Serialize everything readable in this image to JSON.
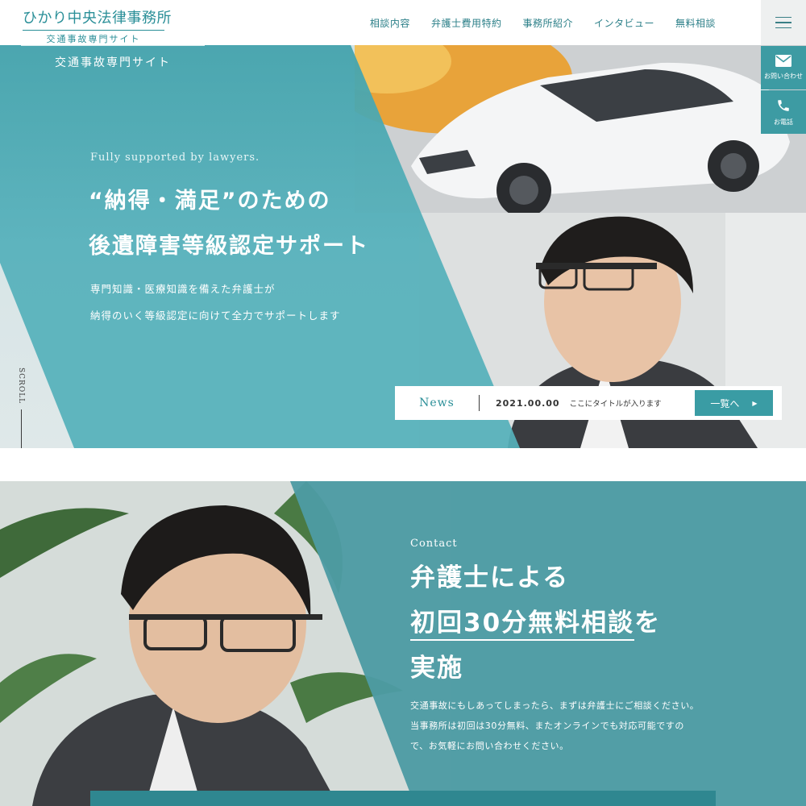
{
  "header": {
    "logo_main": "ひかり中央法律事務所",
    "logo_sub": "交通事故専門サイト",
    "nav": [
      "相談内容",
      "弁護士費用特約",
      "事務所紹介",
      "インタビュー",
      "無料相談"
    ]
  },
  "side": {
    "mail_label": "お問い合わせ",
    "tel_label": "お電話"
  },
  "hero": {
    "site_name": "交通事故専門サイト",
    "en": "Fully supported by lawyers.",
    "title_line1": "“納得・満足”のための",
    "title_line2": "後遺障害等級認定サポート",
    "desc_line1": "専門知識・医療知識を備えた弁護士が",
    "desc_line2": "納得のいく等級認定に向けて全力でサポートします",
    "scroll": "SCROLL"
  },
  "news": {
    "title": "News",
    "date": "2021.00.00",
    "text": "ここにタイトルが入ります",
    "button": "一覧へ",
    "button_arrow": "▶"
  },
  "contact": {
    "en": "Contact",
    "title_line1": "弁護士による",
    "title_line2_underlined": "初回30分無料相談",
    "title_line2_rest": "を",
    "title_line3": "実施",
    "desc": "交通事故にもしあってしまったら、まずは弁護士にご相談ください。当事務所は初回は30分無料、またオンラインでも対応可能ですので、お気軽にお問い合わせください。"
  },
  "colors": {
    "brand_teal": "#55b0ba",
    "deep_teal": "#3a9ca4",
    "text": "#3a3a3a"
  }
}
